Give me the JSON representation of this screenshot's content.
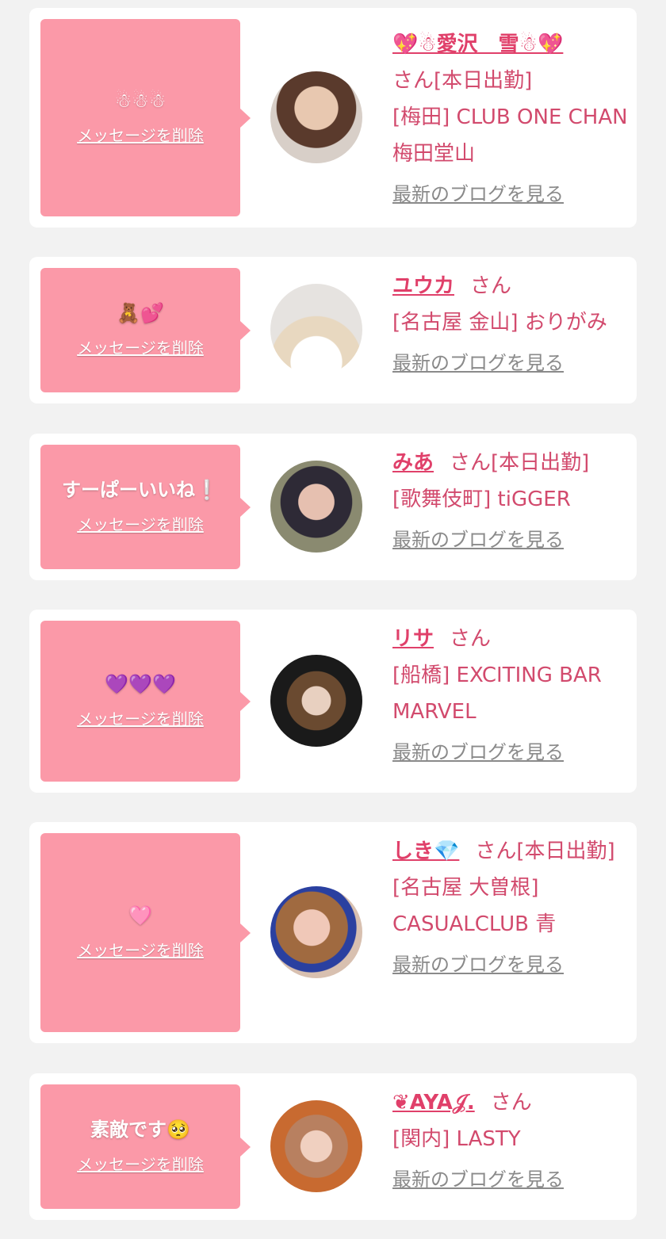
{
  "colors": {
    "page_bg": "#f2f2f2",
    "card_bg": "#ffffff",
    "bubble": "#fb99a8",
    "name": "#e0406a",
    "info": "#d24a6d",
    "blog_link": "#8a8a8a"
  },
  "delete_label": "メッセージを削除",
  "blog_label": "最新のブログを見る",
  "entries": [
    {
      "message": "☃☃☃",
      "name": "💖☃愛沢　雪☃💖",
      "suffix": "さん[本日出勤]",
      "shop": "[梅田] CLUB ONE CHAN 梅田堂山",
      "avatar_icon": "avatar-photo"
    },
    {
      "message": "🧸💕",
      "name": "ユウカ",
      "suffix": "さん",
      "shop": "[名古屋 金山] おりがみ",
      "avatar_icon": "avatar-photo"
    },
    {
      "message": "すーぱーいいね❕",
      "name": "みあ",
      "suffix": "さん[本日出勤]",
      "shop": "[歌舞伎町] tiGGER",
      "avatar_icon": "avatar-photo"
    },
    {
      "message": "💜💜💜",
      "name": "リサ",
      "suffix": "さん",
      "shop": "[船橋] EXCITING BAR MARVEL",
      "avatar_icon": "avatar-photo"
    },
    {
      "message": "🩷",
      "name": "しき💎",
      "suffix": "さん[本日出勤]",
      "shop": "[名古屋 大曽根] CASUALCLUB 青",
      "avatar_icon": "avatar-photo"
    },
    {
      "message": "素敵です🥺",
      "name": "❦AYA𝒥.",
      "suffix": "さん",
      "shop": "[関内] LASTY",
      "avatar_icon": "avatar-photo"
    }
  ]
}
